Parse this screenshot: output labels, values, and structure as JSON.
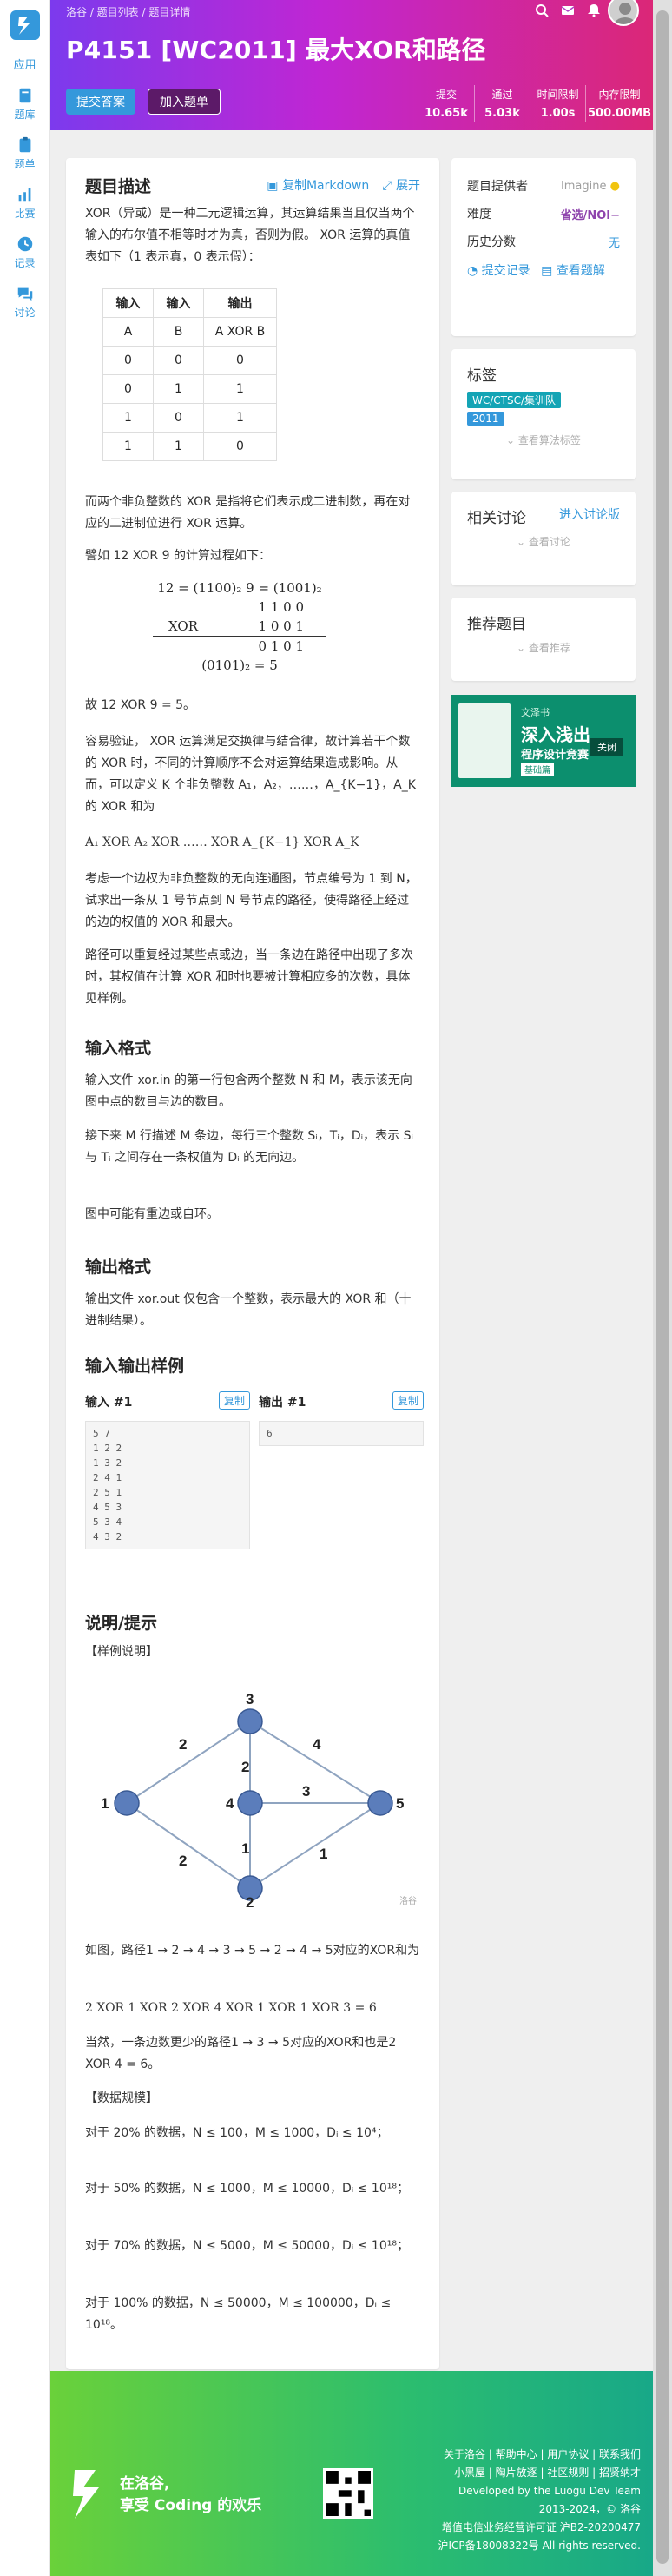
{
  "sidebar": {
    "app": "应用",
    "items": [
      {
        "label": "题库",
        "icon": "book-icon"
      },
      {
        "label": "题单",
        "icon": "clipboard-icon"
      },
      {
        "label": "比赛",
        "icon": "bar-chart-icon"
      },
      {
        "label": "记录",
        "icon": "record-icon"
      },
      {
        "label": "讨论",
        "icon": "chat-icon"
      }
    ]
  },
  "header": {
    "breadcrumb": "洛谷 / 题目列表 / 题目详情",
    "title": "P4151 [WC2011] 最大XOR和路径",
    "submit": "提交答案",
    "add": "加入题单",
    "stats": [
      {
        "label": "提交",
        "value": "10.65k"
      },
      {
        "label": "通过",
        "value": "5.03k"
      },
      {
        "label": "时间限制",
        "value": "1.00s"
      },
      {
        "label": "内存限制",
        "value": "500.00MB"
      }
    ]
  },
  "main": {
    "heading": "题目描述",
    "copy_md": "复制Markdown",
    "expand": "展开",
    "p1": "XOR（异或）是一种二元逻辑运算，其运算结果当且仅当两个输入的布尔值不相等时才为真，否则为假。 XOR 运算的真值表如下（1 表示真，0 表示假）：",
    "truth_table": {
      "headers": [
        "输入",
        "输入",
        "输出"
      ],
      "rows": [
        [
          "A",
          "B",
          "A XOR B"
        ],
        [
          "0",
          "0",
          "0"
        ],
        [
          "0",
          "1",
          "1"
        ],
        [
          "1",
          "0",
          "1"
        ],
        [
          "1",
          "1",
          "0"
        ]
      ]
    },
    "p2": "而两个非负整数的 XOR 是指将它们表示成二进制数，再在对应的二进制位进行 XOR 运算。",
    "p3": "譬如 12 XOR 9 的计算过程如下：",
    "calc": {
      "line1": "12 = (1100)₂   9 = (1001)₂",
      "line2": "1 1 0 0",
      "line3_op": "XOR",
      "line3": "1 0 0 1",
      "line4": "0 1 0 1",
      "line5": "(0101)₂ = 5"
    },
    "p4": "故 12 XOR 9 = 5。",
    "p5": "容易验证， XOR 运算满足交换律与结合律，故计算若干个数的 XOR 时，不同的计算顺序不会对运算结果造成影响。从而，可以定义 K 个非负整数 A₁，A₂，……，A_{K−1}，A_K 的 XOR 和为",
    "p6": "A₁ XOR A₂ XOR …… XOR A_{K−1} XOR A_K",
    "p7": "考虑一个边权为非负整数的无向连通图，节点编号为 1 到 N，试求出一条从 1 号节点到 N 号节点的路径，使得路径上经过的边的权值的 XOR 和最大。",
    "p8": "路径可以重复经过某些点或边，当一条边在路径中出现了多次时，其权值在计算 XOR 和时也要被计算相应多的次数，具体见样例。",
    "input_heading": "输入格式",
    "input_p1": "输入文件 xor.in 的第一行包含两个整数 N 和 M，表示该无向图中点的数目与边的数目。",
    "input_p2": "接下来 M 行描述 M 条边，每行三个整数 Sᵢ，Tᵢ，Dᵢ，表示 Sᵢ 与 Tᵢ 之间存在一条权值为 Dᵢ 的无向边。",
    "input_p3": "图中可能有重边或自环。",
    "output_heading": "输出格式",
    "output_p1": "输出文件 xor.out 仅包含一个整数，表示最大的 XOR 和（十进制结果）。",
    "samples_heading": "输入输出样例",
    "sample_in_label": "输入 #1",
    "sample_out_label": "输出 #1",
    "copy": "复制",
    "sample_in": [
      "5 7",
      "1 2 2",
      "1 3 2",
      "2 4 1",
      "2 5 1",
      "4 5 3",
      "5 3 4",
      "4 3 2"
    ],
    "sample_out": [
      "6"
    ],
    "hint_heading": "说明/提示",
    "hint_sub": "【样例说明】",
    "graph": {
      "nodes": [
        "1",
        "2",
        "3",
        "4",
        "5"
      ],
      "edge_labels": [
        "2",
        "2",
        "4",
        "2",
        "3",
        "1",
        "1"
      ],
      "watermark": "洛谷"
    },
    "h1": "如图，路径1 → 2 → 4 → 3 → 5 → 2 → 4 → 5对应的XOR和为",
    "h2": "2 XOR 1 XOR 2 XOR 4 XOR 1 XOR 1 XOR 3 = 6",
    "h3": "当然，一条边数更少的路径1 → 3 → 5对应的XOR和也是2 XOR 4 = 6。",
    "scale_heading": "【数据规模】",
    "s1": "对于 20% 的数据，N ≤ 100，M ≤ 1000，Dᵢ ≤ 10⁴；",
    "s2": "对于 50% 的数据，N ≤ 1000，M ≤ 10000，Dᵢ ≤ 10¹⁸；",
    "s3": "对于 70% 的数据，N ≤ 5000，M ≤ 50000，Dᵢ ≤ 10¹⁸；",
    "s4": "对于 100% 的数据，N ≤ 50000，M ≤ 100000，Dᵢ ≤ 10¹⁸。"
  },
  "side": {
    "provider_label": "题目提供者",
    "provider": "Imagine",
    "difficulty_label": "难度",
    "difficulty": "省选/NOI−",
    "history_label": "历史分数",
    "history": "无",
    "submit_record": "提交记录",
    "view_solution": "查看题解",
    "tags_title": "标签",
    "tags": [
      "WC/CTSC/集训队",
      "2011"
    ],
    "tags_more": "查看算法标签",
    "discuss_title": "相关讨论",
    "discuss_link": "进入讨论版",
    "discuss_more": "查看讨论",
    "recommend_title": "推荐题目",
    "recommend_more": "查看推荐",
    "ad": {
      "close": "关闭",
      "line1": "文泽书",
      "line2": "深入浅出",
      "line3": "程序设计竞赛",
      "line4": "基础篇"
    }
  },
  "footer": {
    "slogan1": "在洛谷,",
    "slogan2": "享受 Coding 的欢乐",
    "links1": "关于洛谷 | 帮助中心 | 用户协议 | 联系我们",
    "links2": "小黑屋 | 陶片放逐 | 社区规则 | 招贤纳才",
    "l3": "Developed by the Luogu Dev Team",
    "l4": "2013-2024，© 洛谷",
    "l5": "增值电信业务经营许可证 沪B2-20200477",
    "l6": "沪ICP备18008322号 All rights reserved."
  },
  "colors": {
    "accent": "#3498db",
    "header_gradient": [
      "#7c3aed",
      "#db2777"
    ],
    "footer_gradient": [
      "#6ad13a",
      "#18a888"
    ]
  }
}
